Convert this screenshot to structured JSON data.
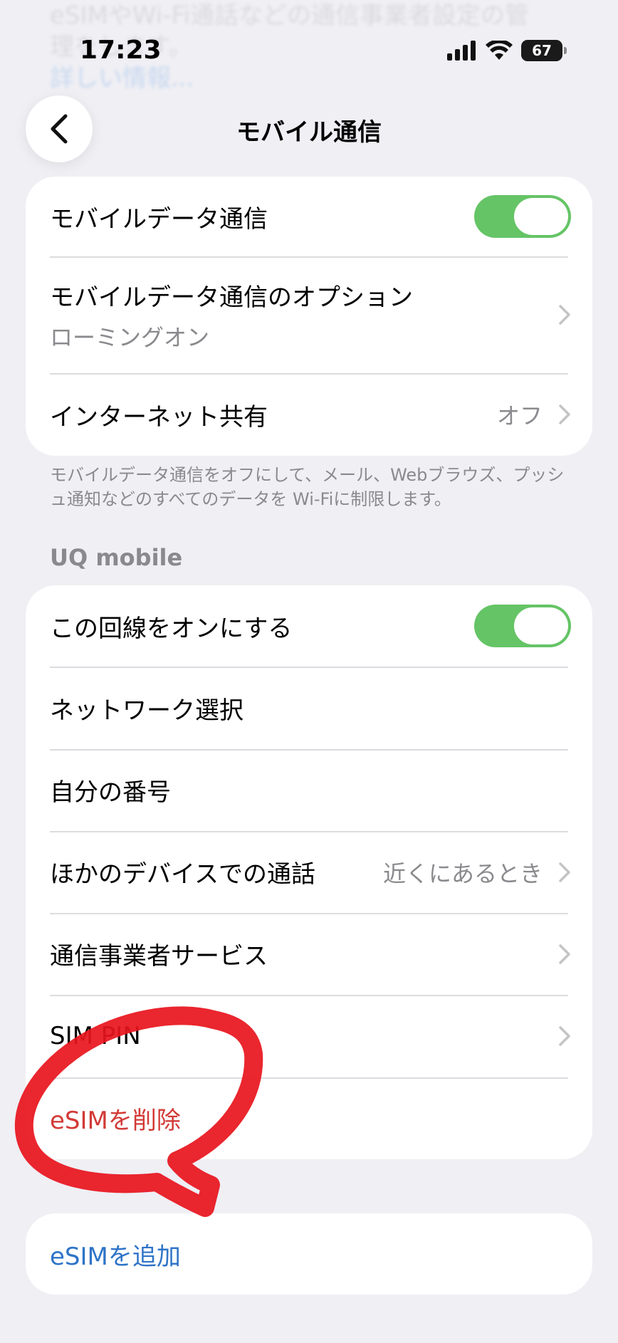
{
  "status_bar": {
    "time": "17:23",
    "battery": "67",
    "icons": [
      "signal-icon",
      "wifi-icon",
      "battery-icon"
    ]
  },
  "nav": {
    "back_icon": "chevron-left-icon",
    "title": "モバイル通信"
  },
  "group1": {
    "mobile_data": {
      "label": "モバイルデータ通信",
      "toggle_on": true
    },
    "data_options": {
      "label": "モバイルデータ通信のオプション",
      "sub": "ローミングオン"
    },
    "hotspot": {
      "label": "インターネット共有",
      "value": "オフ"
    }
  },
  "footer_note": "モバイルデータ通信をオフにして、メール、Webブラウズ、プッシュ通知などのすべてのデータを Wi-Fiに制限します。",
  "carrier": {
    "header": "UQ mobile",
    "line_on": {
      "label": "この回線をオンにする",
      "toggle_on": true
    },
    "network_selection": {
      "label": "ネットワーク選択"
    },
    "my_number": {
      "label": "自分の番号"
    },
    "other_devices": {
      "label": "ほかのデバイスでの通話",
      "value": "近くにあるとき"
    },
    "carrier_services": {
      "label": "通信事業者サービス"
    },
    "sim_pin": {
      "label": "SIM PIN"
    },
    "delete_esim": {
      "label": "eSIMを削除"
    }
  },
  "add_esim": {
    "label": "eSIMを追加"
  },
  "colors": {
    "toggle_on": "#65c466",
    "destructive": "#d23a36",
    "link": "#2e73c7",
    "annotation": "#e8131c"
  }
}
